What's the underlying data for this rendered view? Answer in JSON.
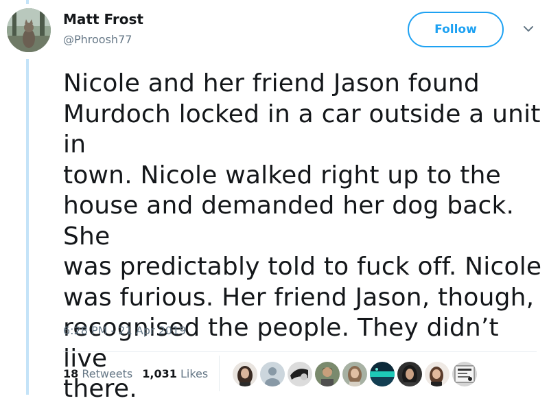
{
  "user": {
    "name": "Matt Frost",
    "handle": "@Phroosh77"
  },
  "follow_label": "Follow",
  "tweet": {
    "text": "Nicole and her friend Jason found\nMurdoch locked in a car outside a unit in\ntown. Nicole walked right up to the\nhouse and demanded her dog back. She\nwas predictably told to fuck off. Nicole\nwas furious. Her friend Jason, though,\nrecognised the people. They didn’t live\nthere.",
    "timestamp": "6:28 PM - 21 Apr 2019"
  },
  "stats": {
    "retweets_count": "18",
    "retweets_label": "Retweets",
    "likes_count": "1,031",
    "likes_label": "Likes"
  },
  "colors": {
    "accent": "#1da1f2",
    "secondary_text": "#657786",
    "thread_line": "#c4e3f8"
  },
  "icons": {
    "caret": "chevron-down-icon"
  }
}
